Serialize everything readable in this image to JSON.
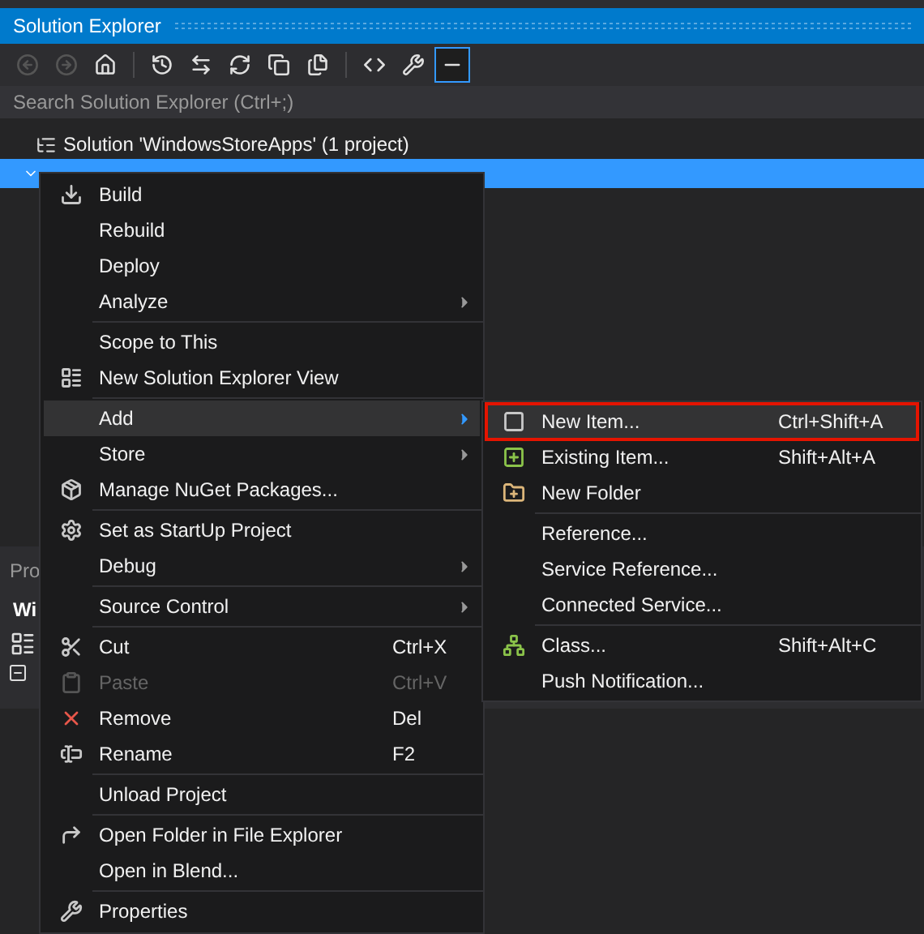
{
  "window": {
    "title": "Solution Explorer"
  },
  "toolbar": {
    "buttons": [
      {
        "disabled": true,
        "selected": false
      },
      {
        "disabled": true,
        "selected": false
      },
      {
        "disabled": false,
        "selected": false
      },
      {
        "disabled": false,
        "selected": false
      },
      {
        "disabled": false,
        "selected": false
      },
      {
        "disabled": false,
        "selected": false
      },
      {
        "disabled": false,
        "selected": false
      },
      {
        "disabled": false,
        "selected": false
      },
      {
        "disabled": false,
        "selected": false
      },
      {
        "disabled": false,
        "selected": false
      },
      {
        "disabled": false,
        "selected": true
      }
    ]
  },
  "search": {
    "placeholder": "Search Solution Explorer (Ctrl+;)"
  },
  "tree": [
    {
      "label": "Solution 'WindowsStoreApps' (1 project)",
      "selected": false,
      "expanded": false
    },
    {
      "selected": true,
      "expanded": true
    }
  ],
  "properties_panel": {
    "title": "Pro",
    "subtitle": "Wi"
  },
  "context_menu": {
    "items": [
      {
        "kind": "item",
        "label": "Build",
        "submenu": false,
        "disabled": false,
        "selected": false
      },
      {
        "kind": "item",
        "label": "Rebuild",
        "submenu": false,
        "disabled": false,
        "selected": false
      },
      {
        "kind": "item",
        "label": "Deploy",
        "submenu": false,
        "disabled": false,
        "selected": false
      },
      {
        "kind": "item",
        "label": "Analyze",
        "submenu": true,
        "disabled": false,
        "selected": false
      },
      {
        "kind": "separator"
      },
      {
        "kind": "item",
        "label": "Scope to This",
        "submenu": false,
        "disabled": false,
        "selected": false
      },
      {
        "kind": "item",
        "label": "New Solution Explorer View",
        "submenu": false,
        "disabled": false,
        "selected": false
      },
      {
        "kind": "separator"
      },
      {
        "kind": "item",
        "label": "Add",
        "submenu": true,
        "disabled": false,
        "selected": true
      },
      {
        "kind": "item",
        "label": "Store",
        "submenu": true,
        "disabled": false,
        "selected": false
      },
      {
        "kind": "item",
        "label": "Manage NuGet Packages...",
        "submenu": false,
        "disabled": false,
        "selected": false
      },
      {
        "kind": "separator"
      },
      {
        "kind": "item",
        "label": "Set as StartUp Project",
        "submenu": false,
        "disabled": false,
        "selected": false
      },
      {
        "kind": "item",
        "label": "Debug",
        "submenu": true,
        "disabled": false,
        "selected": false
      },
      {
        "kind": "separator"
      },
      {
        "kind": "item",
        "label": "Source Control",
        "submenu": true,
        "disabled": false,
        "selected": false
      },
      {
        "kind": "separator"
      },
      {
        "kind": "item",
        "label": "Cut",
        "shortcut": "Ctrl+X",
        "submenu": false,
        "disabled": false,
        "selected": false
      },
      {
        "kind": "item",
        "label": "Paste",
        "shortcut": "Ctrl+V",
        "submenu": false,
        "disabled": true,
        "selected": false
      },
      {
        "kind": "item",
        "label": "Remove",
        "shortcut": "Del",
        "submenu": false,
        "disabled": false,
        "selected": false
      },
      {
        "kind": "item",
        "label": "Rename",
        "shortcut": "F2",
        "submenu": false,
        "disabled": false,
        "selected": false
      },
      {
        "kind": "separator"
      },
      {
        "kind": "item",
        "label": "Unload Project",
        "submenu": false,
        "disabled": false,
        "selected": false
      },
      {
        "kind": "separator"
      },
      {
        "kind": "item",
        "label": "Open Folder in File Explorer",
        "submenu": false,
        "disabled": false,
        "selected": false
      },
      {
        "kind": "item",
        "label": "Open in Blend...",
        "submenu": false,
        "disabled": false,
        "selected": false
      },
      {
        "kind": "separator"
      },
      {
        "kind": "item",
        "label": "Properties",
        "submenu": false,
        "disabled": false,
        "selected": false
      }
    ]
  },
  "add_submenu": {
    "items": [
      {
        "kind": "item",
        "label": "New Item...",
        "shortcut": "Ctrl+Shift+A",
        "selected": true,
        "outlined": true
      },
      {
        "kind": "item",
        "label": "Existing Item...",
        "shortcut": "Shift+Alt+A",
        "selected": false,
        "outlined": false
      },
      {
        "kind": "item",
        "label": "New Folder",
        "selected": false,
        "outlined": false
      },
      {
        "kind": "separator"
      },
      {
        "kind": "item",
        "label": "Reference...",
        "selected": false,
        "outlined": false
      },
      {
        "kind": "item",
        "label": "Service Reference...",
        "selected": false,
        "outlined": false
      },
      {
        "kind": "item",
        "label": "Connected Service...",
        "selected": false,
        "outlined": false
      },
      {
        "kind": "separator"
      },
      {
        "kind": "item",
        "label": "Class...",
        "shortcut": "Shift+Alt+C",
        "selected": false,
        "outlined": false
      },
      {
        "kind": "item",
        "label": "Push Notification...",
        "selected": false,
        "outlined": false
      }
    ]
  }
}
